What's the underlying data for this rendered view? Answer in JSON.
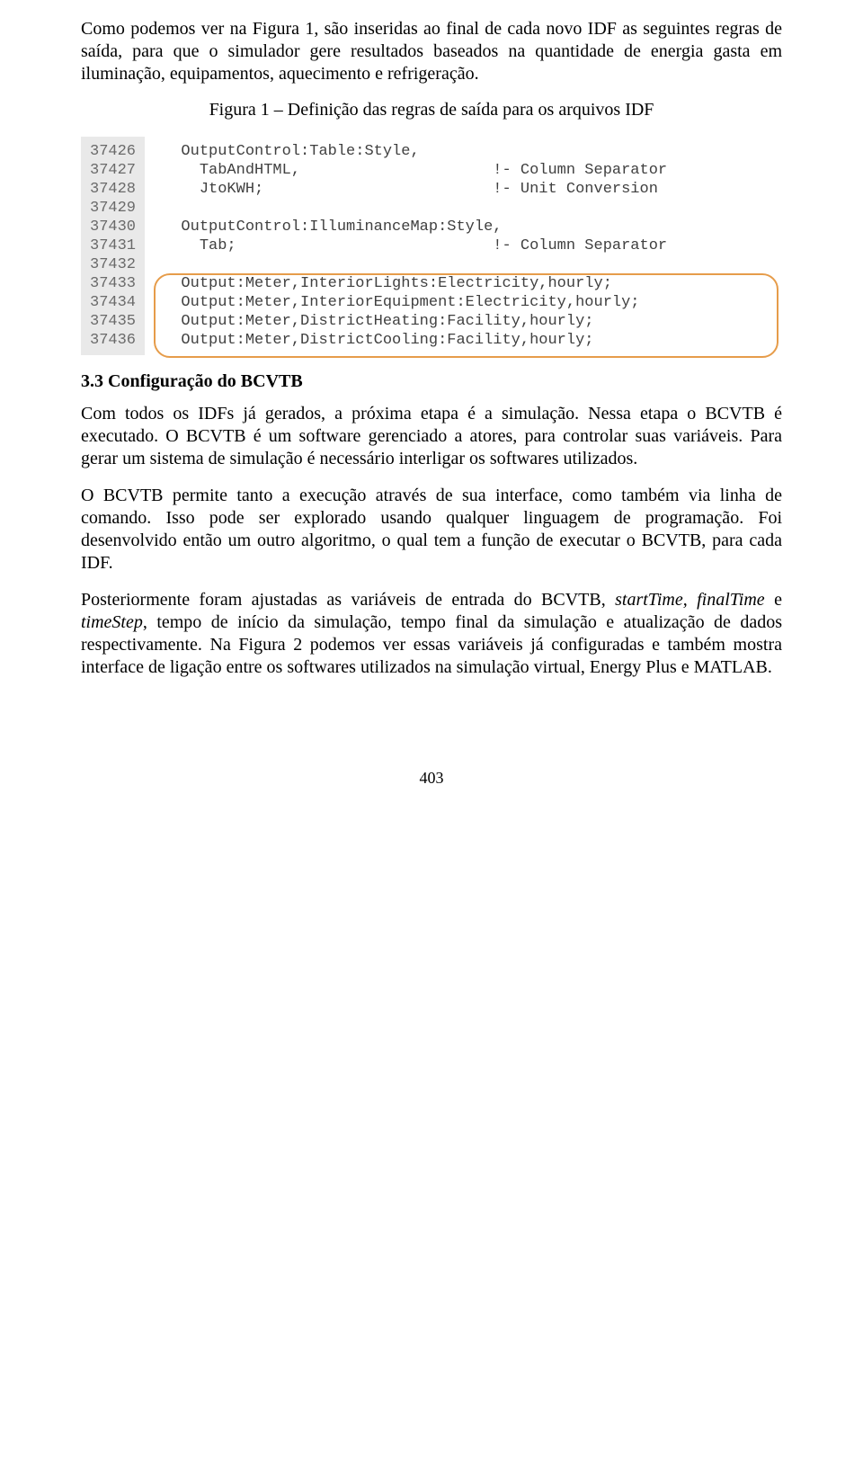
{
  "paragraphs": {
    "intro": "Como podemos ver na Figura 1, são inseridas ao final de cada novo IDF as seguintes regras de saída, para que o simulador gere resultados baseados na quantidade de energia gasta em iluminação, equipamentos, aquecimento e refrigeração.",
    "fig1_caption": "Figura 1 – Definição das regras de saída para os arquivos IDF",
    "p_bcvtb_1": "Com todos os IDFs já gerados, a próxima etapa é a simulação. Nessa etapa o BCVTB é executado. O BCVTB é um software gerenciado a atores, para controlar suas variáveis. Para gerar um sistema de simulação é necessário interligar os softwares utilizados.",
    "p_bcvtb_2": "O BCVTB permite tanto a execução através de sua interface, como também via linha de comando. Isso pode ser explorado usando qualquer linguagem de programação. Foi desenvolvido então um outro algoritmo, o qual tem a função de executar o BCVTB, para cada IDF.",
    "p_bcvtb_3a": "Posteriormente foram ajustadas as variáveis de entrada do BCVTB, ",
    "p_bcvtb_3b_italic": "startTime, finalTime",
    "p_bcvtb_3c": " e ",
    "p_bcvtb_3d_italic": "timeStep",
    "p_bcvtb_3e": ", tempo de início da simulação, tempo final da simulação e atualização de dados respectivamente. Na Figura 2 podemos ver essas variáveis já configuradas e também mostra interface de ligação entre os softwares utilizados na simulação virtual, Energy Plus e MATLAB."
  },
  "section": {
    "heading_33": "3.3 Configuração do BCVTB"
  },
  "code": {
    "line_numbers": [
      "37426",
      "37427",
      "37428",
      "37429",
      "37430",
      "37431",
      "37432",
      "37433",
      "37434",
      "37435",
      "37436"
    ],
    "lines": [
      "  OutputControl:Table:Style,",
      "    TabAndHTML,                     !- Column Separator",
      "    JtoKWH;                         !- Unit Conversion",
      "",
      "  OutputControl:IlluminanceMap:Style,",
      "    Tab;                            !- Column Separator",
      "",
      "  Output:Meter,InteriorLights:Electricity,hourly;",
      "  Output:Meter,InteriorEquipment:Electricity,hourly;",
      "  Output:Meter,DistrictHeating:Facility,hourly;",
      "  Output:Meter,DistrictCooling:Facility,hourly;"
    ]
  },
  "page_number": "403"
}
